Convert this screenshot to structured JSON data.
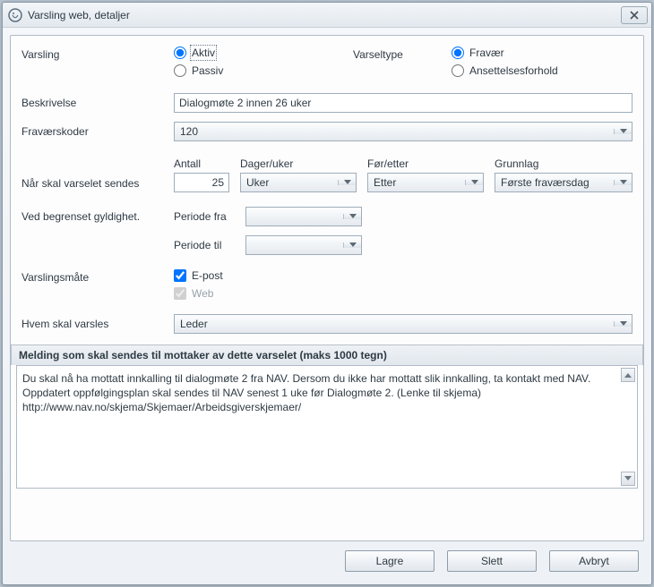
{
  "window": {
    "title": "Varsling web, detaljer"
  },
  "labels": {
    "varsling": "Varsling",
    "varseltype": "Varseltype",
    "beskrivelse": "Beskrivelse",
    "fravaerskoder": "Fraværskoder",
    "naar_sendes": "Når skal varselet sendes",
    "ved_begrenset": "Ved begrenset gyldighet.",
    "varslingsmaate": "Varslingsmåte",
    "hvem": "Hvem skal varsles",
    "periode_fra": "Periode fra",
    "periode_til": "Periode til"
  },
  "radios": {
    "aktiv": "Aktiv",
    "passiv": "Passiv",
    "fravaer": "Fravær",
    "ansettelse": "Ansettelsesforhold"
  },
  "cols": {
    "antall": "Antall",
    "dager_uker": "Dager/uker",
    "foer_etter": "Før/etter",
    "grunnlag": "Grunnlag"
  },
  "values": {
    "beskrivelse": "Dialogmøte 2 innen 26 uker",
    "fravaerskoder": "120",
    "antall": "25",
    "dager_uker": "Uker",
    "foer_etter": "Etter",
    "grunnlag": "Første fraværsdag",
    "periode_fra": "",
    "periode_til": "",
    "hvem": "Leder"
  },
  "checks": {
    "epost": "E-post",
    "web": "Web"
  },
  "section": {
    "melding_header": "Melding som skal sendes til mottaker av dette varselet (maks 1000 tegn)"
  },
  "message": "Du skal nå ha mottatt innkalling til dialogmøte 2 fra NAV. Dersom du ikke har mottatt slik innkalling, ta kontakt med NAV.\nOppdatert oppfølgingsplan skal sendes til NAV senest 1 uke før Dialogmøte 2. (Lenke til skjema)\nhttp://www.nav.no/skjema/Skjemaer/Arbeidsgiverskjemaer/",
  "buttons": {
    "lagre": "Lagre",
    "slett": "Slett",
    "avbryt": "Avbryt"
  }
}
